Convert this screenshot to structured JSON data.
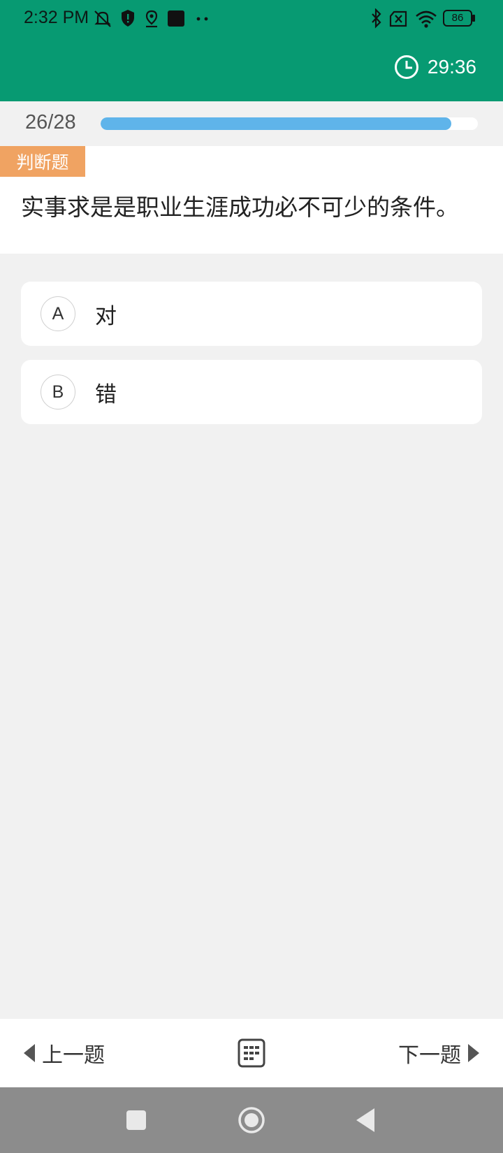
{
  "status_bar": {
    "time": "2:32 PM",
    "battery": "86",
    "left_icons": [
      "mute-bell-icon",
      "shield-alert-icon",
      "location-pin-icon",
      "app-square-icon",
      "more-dots-icon"
    ],
    "right_icons": [
      "bluetooth-icon",
      "no-sim-icon",
      "wifi-icon",
      "battery-icon"
    ]
  },
  "header": {
    "timer": "29:36",
    "timer_icon": "clock-icon"
  },
  "progress": {
    "label": "26/28",
    "current": 26,
    "total": 28,
    "fill_fraction": 0.93,
    "fill_color": "#5fb4ea"
  },
  "question": {
    "type_badge": "判断题",
    "text": "实事求是是职业生涯成功必不可少的条件。",
    "badge_color": "#f0a362"
  },
  "options": [
    {
      "letter": "A",
      "text": "对"
    },
    {
      "letter": "B",
      "text": "错"
    }
  ],
  "bottom_nav": {
    "prev_label": "上一题",
    "next_label": "下一题",
    "answer_card_icon": "answer-sheet-icon"
  },
  "colors": {
    "header_green": "#079a72",
    "page_bg": "#f1f1f1",
    "system_nav_bg": "#8c8c8c"
  }
}
